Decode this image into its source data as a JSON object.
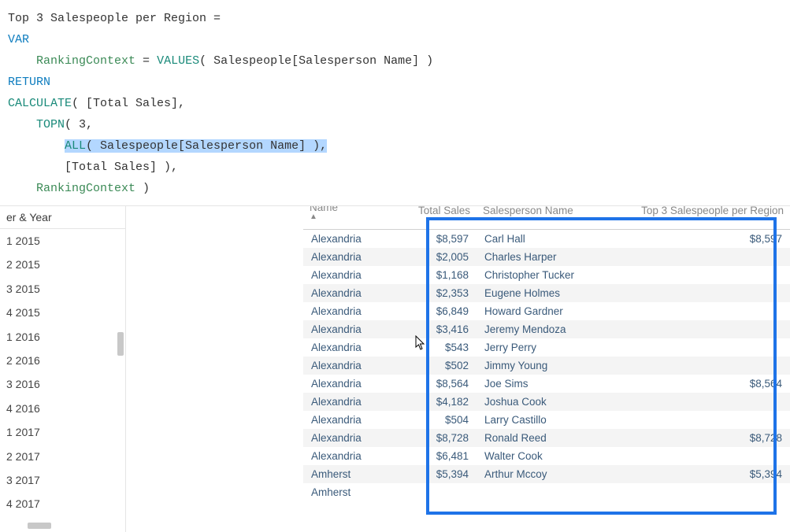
{
  "formula": {
    "line1_name": "Top 3 Salespeople per Region ",
    "line1_eq": "=",
    "line2_var": "VAR",
    "line3_indent": "    ",
    "line3_id": "RankingContext",
    "line3_mid": " = ",
    "line3_fn": "VALUES",
    "line3_rest": "( Salespeople[Salesperson Name] )",
    "line4_return": "RETURN",
    "line5_fn": "CALCULATE",
    "line5_rest": "( [Total Sales],",
    "line6_indent": "    ",
    "line6_fn": "TOPN",
    "line6_rest": "( 3,",
    "line7_indent": "        ",
    "line7_hl_fn": "ALL",
    "line7_hl_rest": "( Salespeople[Salesperson Name] ),",
    "line8_indent": "        ",
    "line8_rest": "[Total Sales] ),",
    "line9_indent": "    ",
    "line9_id": "RankingContext",
    "line9_rest": " )"
  },
  "leftPanel": {
    "header": "er & Year",
    "items": [
      "1 2015",
      "2 2015",
      "3 2015",
      "4 2015",
      "1 2016",
      "2 2016",
      "3 2016",
      "4 2016",
      "1 2017",
      "2 2017",
      "3 2017",
      "4 2017"
    ]
  },
  "table": {
    "headers": [
      "Name",
      "Total Sales",
      "Salesperson Name",
      "Top 3 Salespeople per Region"
    ],
    "rows": [
      {
        "name": "Alexandria",
        "sales": "$8,597",
        "person": "Carl Hall",
        "top3": "$8,597"
      },
      {
        "name": "Alexandria",
        "sales": "$2,005",
        "person": "Charles Harper",
        "top3": ""
      },
      {
        "name": "Alexandria",
        "sales": "$1,168",
        "person": "Christopher Tucker",
        "top3": ""
      },
      {
        "name": "Alexandria",
        "sales": "$2,353",
        "person": "Eugene Holmes",
        "top3": ""
      },
      {
        "name": "Alexandria",
        "sales": "$6,849",
        "person": "Howard Gardner",
        "top3": ""
      },
      {
        "name": "Alexandria",
        "sales": "$3,416",
        "person": "Jeremy Mendoza",
        "top3": ""
      },
      {
        "name": "Alexandria",
        "sales": "$543",
        "person": "Jerry Perry",
        "top3": ""
      },
      {
        "name": "Alexandria",
        "sales": "$502",
        "person": "Jimmy Young",
        "top3": ""
      },
      {
        "name": "Alexandria",
        "sales": "$8,564",
        "person": "Joe Sims",
        "top3": "$8,564"
      },
      {
        "name": "Alexandria",
        "sales": "$4,182",
        "person": "Joshua Cook",
        "top3": ""
      },
      {
        "name": "Alexandria",
        "sales": "$504",
        "person": "Larry Castillo",
        "top3": ""
      },
      {
        "name": "Alexandria",
        "sales": "$8,728",
        "person": "Ronald Reed",
        "top3": "$8,728"
      },
      {
        "name": "Alexandria",
        "sales": "$6,481",
        "person": "Walter Cook",
        "top3": ""
      },
      {
        "name": "Amherst",
        "sales": "$5,394",
        "person": "Arthur Mccoy",
        "top3": "$5,394"
      },
      {
        "name": "Amherst",
        "sales": "",
        "person": "",
        "top3": ""
      }
    ]
  }
}
